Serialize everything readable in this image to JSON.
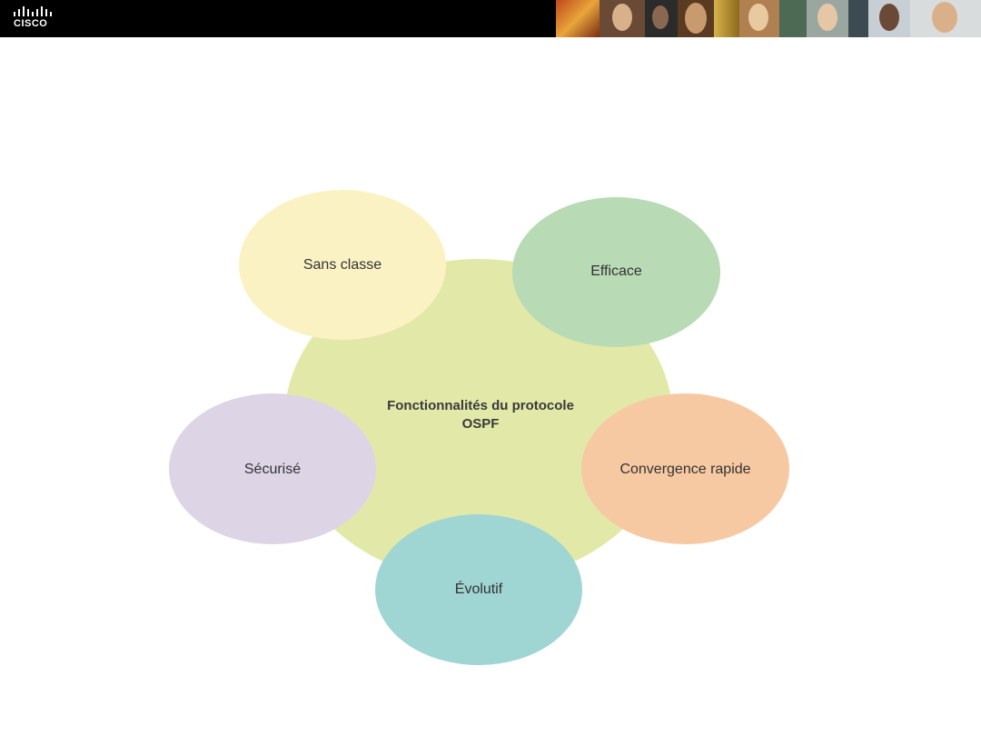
{
  "header": {
    "logo_text": "CISCO",
    "background_color": "#000000"
  },
  "diagram": {
    "center_label": "Fonctionnalités du protocole OSPF",
    "center_color": "#e2e9a8",
    "nodes": [
      {
        "label": "Sans classe",
        "color": "#fbf2c4"
      },
      {
        "label": "Efficace",
        "color": "#b8dab4"
      },
      {
        "label": "Convergence rapide",
        "color": "#f7c9a3"
      },
      {
        "label": "Évolutif",
        "color": "#9fd5d2"
      },
      {
        "label": "Sécurisé",
        "color": "#ddd4e6"
      }
    ]
  }
}
